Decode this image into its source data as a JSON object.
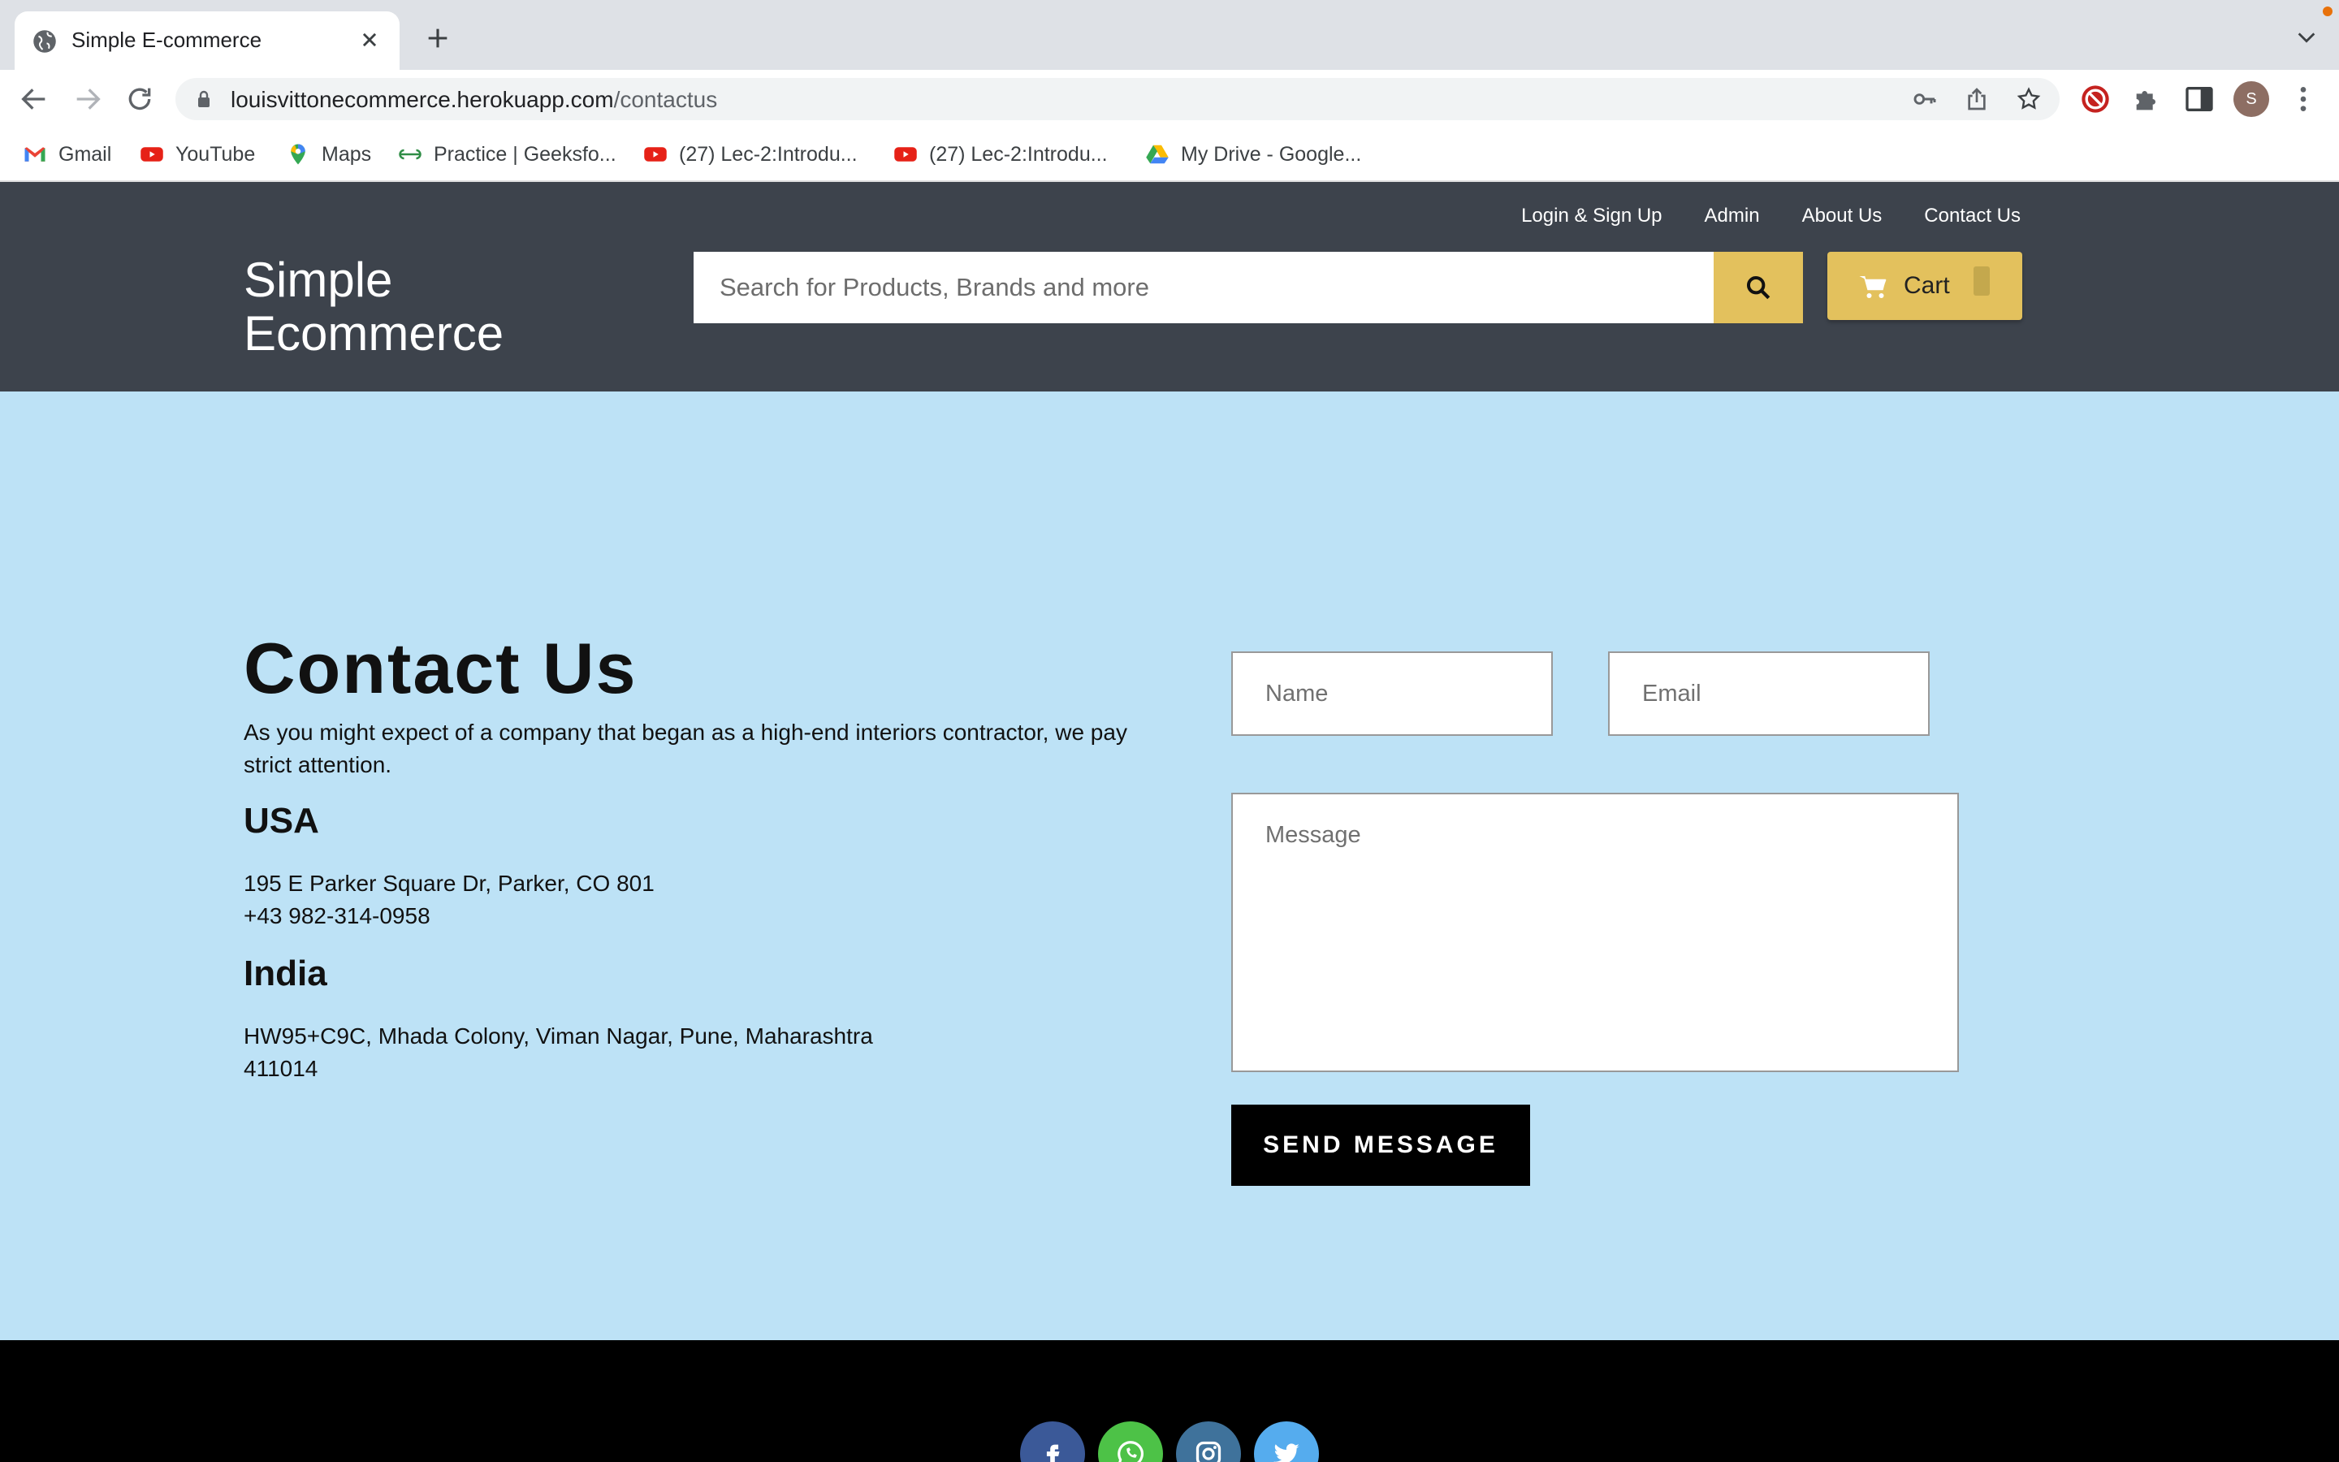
{
  "browser": {
    "tab_title": "Simple E-commerce",
    "url_host": "louisvittonecommerce.herokuapp.com",
    "url_path": "/contactus",
    "profile_initial": "S",
    "bookmarks": [
      {
        "label": "Gmail",
        "icon": "gmail-icon"
      },
      {
        "label": "YouTube",
        "icon": "youtube-icon"
      },
      {
        "label": "Maps",
        "icon": "maps-icon"
      },
      {
        "label": "Practice | Geeksfo...",
        "icon": "geeksforgeeks-icon"
      },
      {
        "label": "(27) Lec-2:Introdu...",
        "icon": "youtube-icon"
      },
      {
        "label": "(27) Lec-2:Introdu...",
        "icon": "youtube-icon"
      },
      {
        "label": "My Drive - Google...",
        "icon": "google-drive-icon"
      }
    ]
  },
  "header": {
    "logo_line1": "Simple",
    "logo_line2": "Ecommerce",
    "links": [
      "Login & Sign Up",
      "Admin",
      "About Us",
      "Contact Us"
    ],
    "search_placeholder": "Search for Products, Brands and more",
    "cart_label": "Cart"
  },
  "contact": {
    "title": "Contact Us",
    "description": "As you might expect of a company that began as a high-end interiors contractor, we pay strict attention.",
    "regions": [
      {
        "name": "USA",
        "address": "195 E Parker Square Dr, Parker, CO 801",
        "phone": "+43 982-314-0958"
      },
      {
        "name": "India",
        "address": "HW95+C9C, Mhada Colony, Viman Nagar, Pune, Maharashtra",
        "postcode": "411014"
      }
    ],
    "form": {
      "name_placeholder": "Name",
      "email_placeholder": "Email",
      "message_placeholder": "Message",
      "send_label": "SEND MESSAGE"
    }
  },
  "footer": {
    "social": [
      "facebook-icon",
      "whatsapp-icon",
      "instagram-icon",
      "twitter-icon"
    ]
  },
  "colors": {
    "header_bg": "#3d434c",
    "accent": "#e3c15d",
    "main_bg": "#bde2f6",
    "footer_bg": "#000000"
  }
}
